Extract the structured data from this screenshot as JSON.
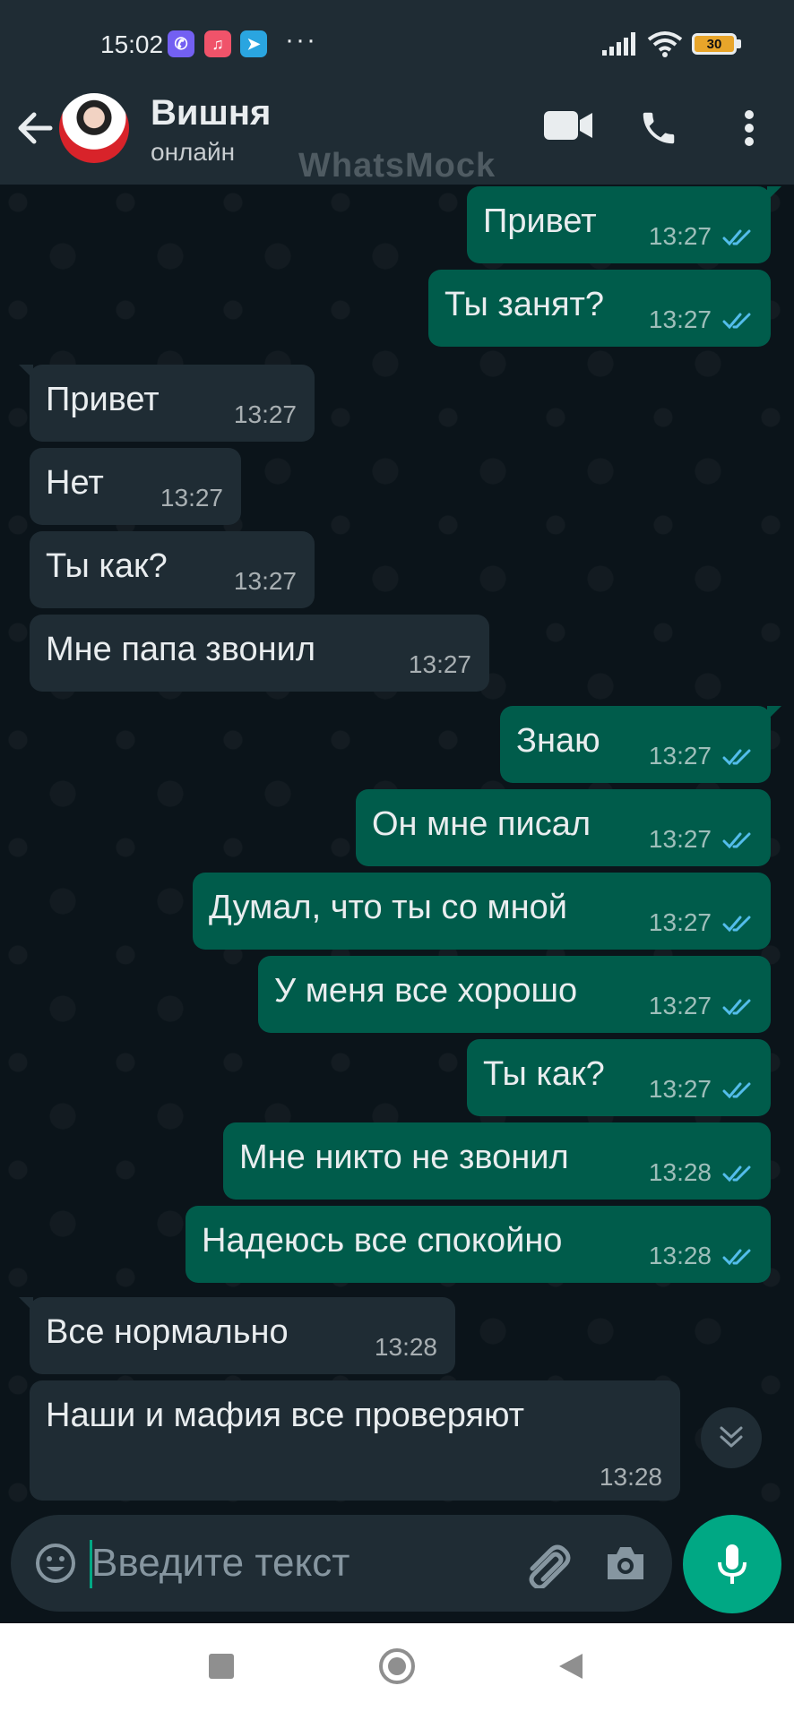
{
  "status_bar": {
    "time": "15:02",
    "battery": "30",
    "more": "···"
  },
  "header": {
    "contact_name": "Вишня",
    "contact_status": "онлайн",
    "watermark": "WhatsMock"
  },
  "messages": [
    {
      "dir": "out",
      "text": "Привет",
      "time": "13:27"
    },
    {
      "dir": "out",
      "text": "Ты занят?",
      "time": "13:27"
    },
    {
      "dir": "in",
      "text": "Привет",
      "time": "13:27"
    },
    {
      "dir": "in",
      "text": "Нет",
      "time": "13:27"
    },
    {
      "dir": "in",
      "text": "Ты как?",
      "time": "13:27"
    },
    {
      "dir": "in",
      "text": "Мне папа звонил",
      "time": "13:27"
    },
    {
      "dir": "out",
      "text": "Знаю",
      "time": "13:27"
    },
    {
      "dir": "out",
      "text": "Он мне писал",
      "time": "13:27"
    },
    {
      "dir": "out",
      "text": "Думал, что ты со мной",
      "time": "13:27"
    },
    {
      "dir": "out",
      "text": "У меня все хорошо",
      "time": "13:27"
    },
    {
      "dir": "out",
      "text": "Ты как?",
      "time": "13:27"
    },
    {
      "dir": "out",
      "text": "Мне никто не звонил",
      "time": "13:28"
    },
    {
      "dir": "out",
      "text": "Надеюсь все спокойно",
      "time": "13:28"
    },
    {
      "dir": "in",
      "text": "Все нормально",
      "time": "13:28"
    },
    {
      "dir": "in",
      "text": "Наши и мафия все проверяют",
      "time": "13:28"
    }
  ],
  "input": {
    "placeholder": "Введите текст"
  },
  "colors": {
    "background": "#0b141a",
    "bar": "#1f2c34",
    "outgoing_bubble": "#005c4b",
    "incoming_bubble": "#1f2c34",
    "read_tick": "#53bdeb",
    "accent": "#00a884"
  },
  "icons": {
    "back": "arrow-left-icon",
    "video": "video-camera-icon",
    "call": "phone-icon",
    "menu": "more-vertical-icon",
    "emoji": "emoji-icon",
    "attach": "paperclip-icon",
    "camera": "camera-icon",
    "mic": "microphone-icon",
    "scroll": "double-chevron-down-icon"
  }
}
